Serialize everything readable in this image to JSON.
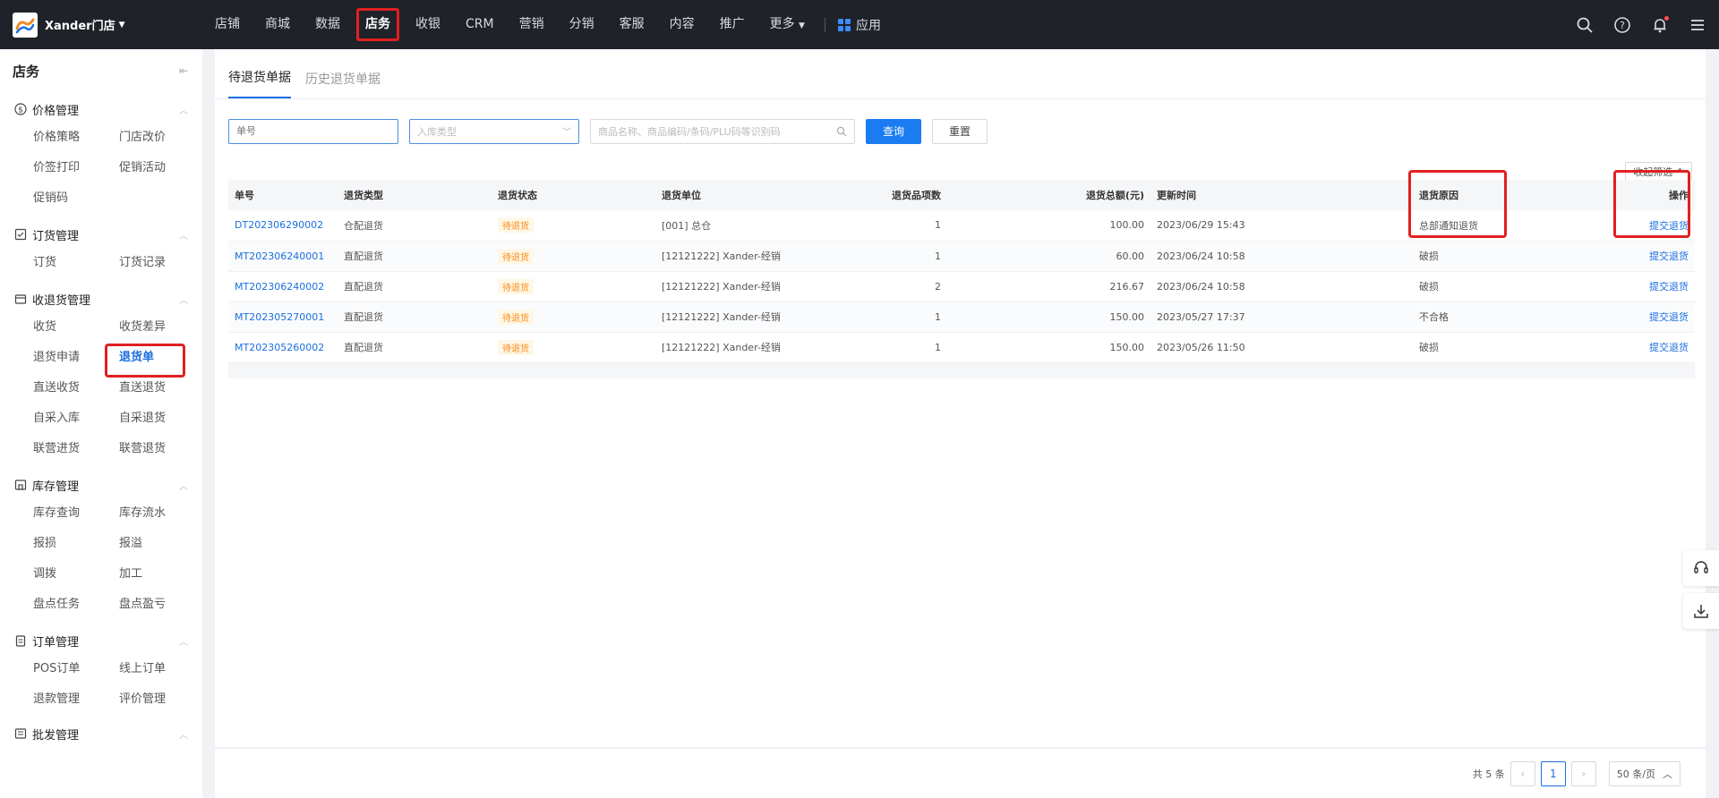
{
  "brand": {
    "name": "Xander门店"
  },
  "nav": {
    "items": [
      {
        "label": "店铺"
      },
      {
        "label": "商城"
      },
      {
        "label": "数据"
      },
      {
        "label": "店务",
        "active": true
      },
      {
        "label": "收银"
      },
      {
        "label": "CRM"
      },
      {
        "label": "营销"
      },
      {
        "label": "分销"
      },
      {
        "label": "客服"
      },
      {
        "label": "内容"
      },
      {
        "label": "推广"
      },
      {
        "label": "更多"
      }
    ],
    "app_label": "应用"
  },
  "sidebar": {
    "title": "店务",
    "groups": [
      {
        "title": "价格管理",
        "icon": "dollar-circle-icon",
        "items": [
          "价格策略",
          "门店改价",
          "价签打印",
          "促销活动",
          "促销码"
        ]
      },
      {
        "title": "订货管理",
        "icon": "cart-check-icon",
        "items": [
          "订货",
          "订货记录"
        ]
      },
      {
        "title": "收退货管理",
        "icon": "box-return-icon",
        "items": [
          "收货",
          "收货差异",
          "退货申请",
          "退货单",
          "直送收货",
          "直送退货",
          "自采入库",
          "自采退货",
          "联营进货",
          "联营退货"
        ],
        "active": "退货单"
      },
      {
        "title": "库存管理",
        "icon": "warehouse-icon",
        "items": [
          "库存查询",
          "库存流水",
          "报损",
          "报溢",
          "调拨",
          "加工",
          "盘点任务",
          "盘点盈亏"
        ]
      },
      {
        "title": "订单管理",
        "icon": "clipboard-icon",
        "items": [
          "POS订单",
          "线上订单",
          "退款管理",
          "评价管理"
        ]
      },
      {
        "title": "批发管理",
        "icon": "list-icon",
        "items": []
      }
    ]
  },
  "tabs": [
    {
      "label": "待退货单据",
      "active": true
    },
    {
      "label": "历史退货单据"
    }
  ],
  "filters": {
    "order_no_placeholder": "单号",
    "type_placeholder": "入库类型",
    "search_placeholder": "商品名称、商品编码/条码/PLU码等识别码",
    "query_label": "查询",
    "reset_label": "重置",
    "collapse_label": "收起筛选 ⌃"
  },
  "table": {
    "headers": [
      "单号",
      "退货类型",
      "退货状态",
      "退货单位",
      "退货品项数",
      "退货总额(元)",
      "更新时间",
      "退货原因",
      "操作"
    ],
    "rows": [
      {
        "no": "DT202306290002",
        "type": "仓配退货",
        "status": "待退货",
        "unit": "[001] 总仓",
        "count": "1",
        "amount": "100.00",
        "time": "2023/06/29 15:43",
        "reason": "总部通知退货",
        "action": "提交退货"
      },
      {
        "no": "MT202306240001",
        "type": "直配退货",
        "status": "待退货",
        "unit": "[12121222] Xander-经销",
        "count": "1",
        "amount": "60.00",
        "time": "2023/06/24 10:58",
        "reason": "破损",
        "action": "提交退货"
      },
      {
        "no": "MT202306240002",
        "type": "直配退货",
        "status": "待退货",
        "unit": "[12121222] Xander-经销",
        "count": "2",
        "amount": "216.67",
        "time": "2023/06/24 10:58",
        "reason": "破损",
        "action": "提交退货"
      },
      {
        "no": "MT202305270001",
        "type": "直配退货",
        "status": "待退货",
        "unit": "[12121222] Xander-经销",
        "count": "1",
        "amount": "150.00",
        "time": "2023/05/27 17:37",
        "reason": "不合格",
        "action": "提交退货"
      },
      {
        "no": "MT202305260002",
        "type": "直配退货",
        "status": "待退货",
        "unit": "[12121222] Xander-经销",
        "count": "1",
        "amount": "150.00",
        "time": "2023/05/26 11:50",
        "reason": "破损",
        "action": "提交退货"
      }
    ]
  },
  "pagination": {
    "total_label": "共 5 条",
    "current_page": "1",
    "page_size_label": "50 条/页"
  },
  "colors": {
    "topbar": "#1f2229",
    "accent": "#1a6fe0",
    "highlight": "#e02020",
    "badge_text": "#fa8c16"
  }
}
